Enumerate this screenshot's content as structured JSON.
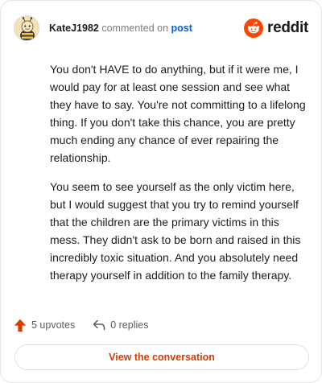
{
  "header": {
    "username": "KateJ1982",
    "verb": "commented on",
    "post_link": "post",
    "logo_text": "reddit",
    "avatar_icon": "bee-avatar-icon",
    "logo_icon": "reddit-alien-icon"
  },
  "comment": {
    "paragraphs": [
      "You don't HAVE to do anything, but if it were me, I would pay for at least one session and see what they have to say. You're not committing to a lifelong thing. If you don't take this chance, you are pretty much ending any chance of ever repairing the relationship.",
      "You seem to see yourself as the only victim here, but I would suggest that you try to remind yourself that the children are the primary victims in this mess. They didn't ask to be born and raised in this incredibly toxic situation. And you absolutely need therapy yourself in addition to the family therapy."
    ]
  },
  "actions": {
    "upvotes": "5 upvotes",
    "replies": "0 replies",
    "upvote_icon": "upvote-arrow-icon",
    "reply_icon": "reply-arrow-icon"
  },
  "cta": {
    "label": "View the conversation"
  },
  "colors": {
    "brand": "#ff4500",
    "link": "#0a5fcc",
    "cta_text": "#d93a00"
  }
}
